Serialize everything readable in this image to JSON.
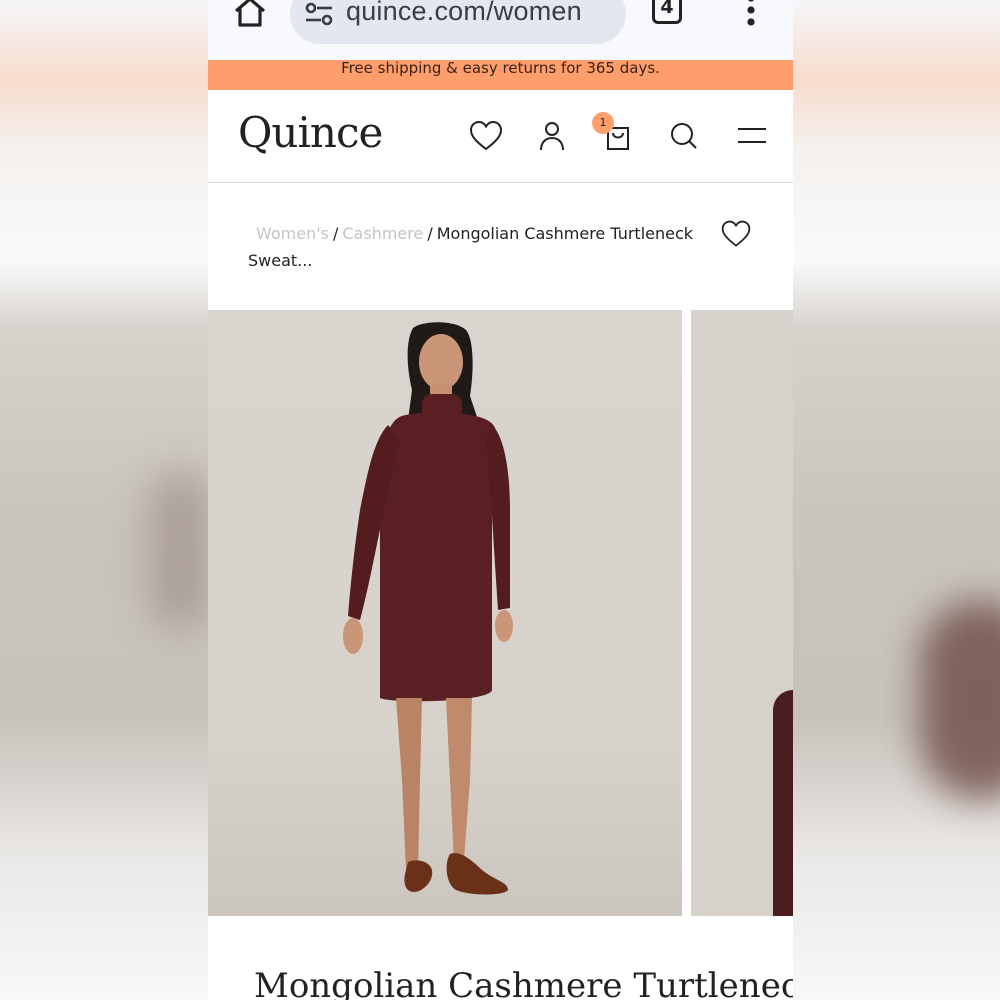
{
  "browser": {
    "url": "quince.com/women",
    "tab_count": "4",
    "icons": [
      "home-icon",
      "page-info-icon",
      "tabs-icon",
      "more-vert-icon"
    ]
  },
  "promo": {
    "text": "Free shipping & easy returns for 365 days."
  },
  "header": {
    "logo": "Quince",
    "cart_count": "1",
    "icons": [
      "heart-icon",
      "account-icon",
      "cart-icon",
      "search-icon",
      "menu-icon"
    ],
    "accent": "#ff9e6d"
  },
  "breadcrumb": {
    "items": [
      "Women's",
      "Cashmere"
    ],
    "current": "Mongolian Cashmere Turtleneck Sweat..."
  },
  "product": {
    "title": "Mongolian Cashmere Turtleneck",
    "color": "#5a1f22"
  }
}
